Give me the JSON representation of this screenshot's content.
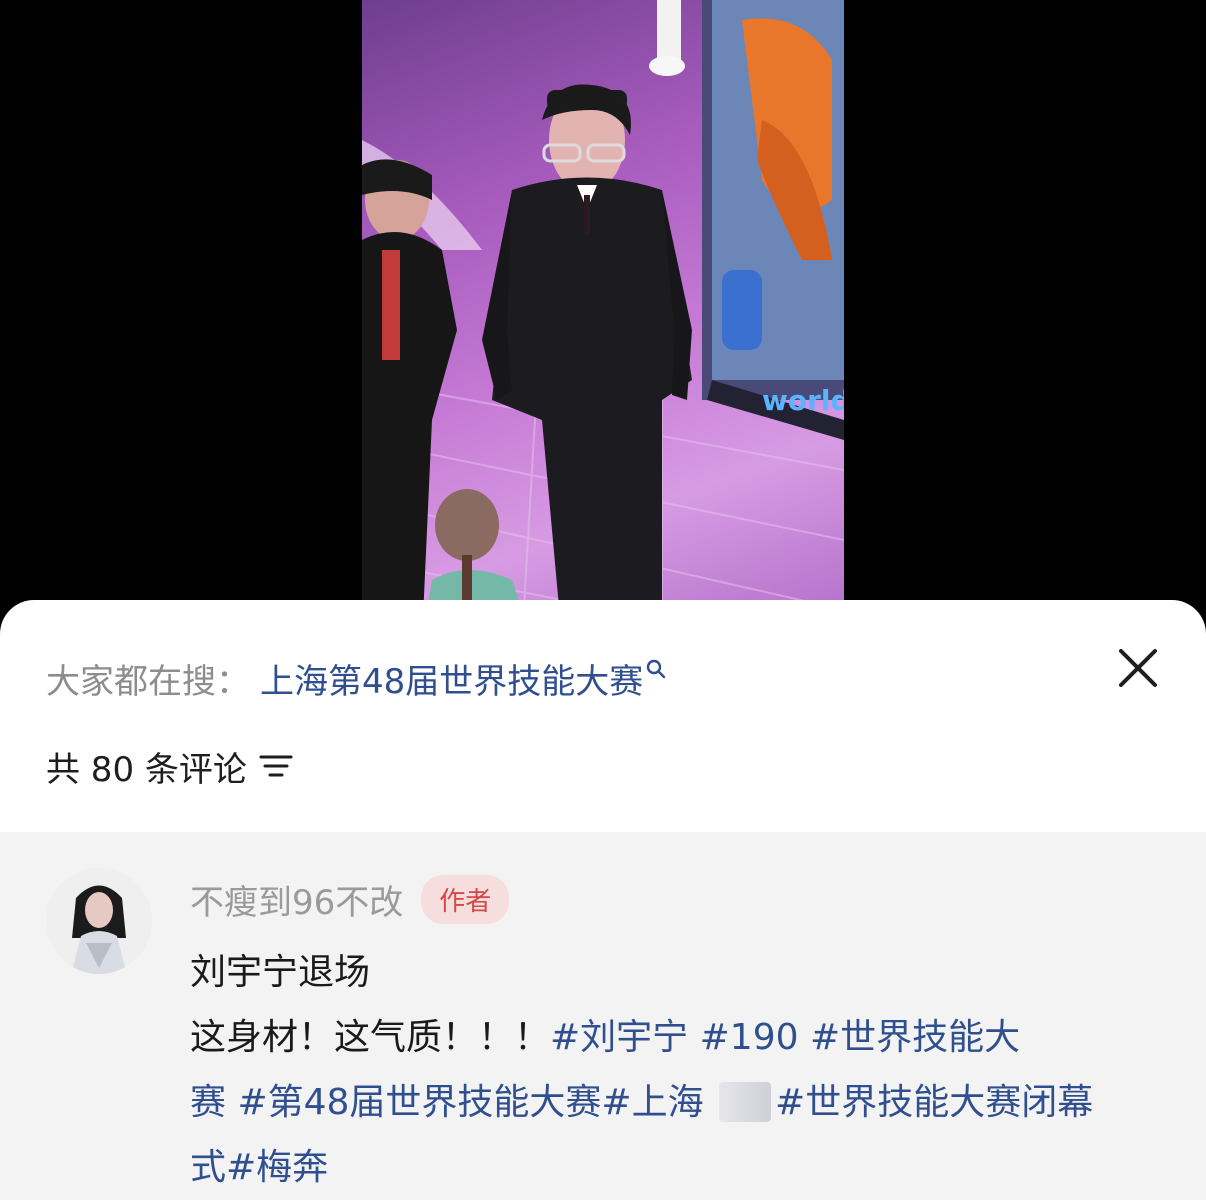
{
  "search_bar": {
    "prefix": "大家都在搜：",
    "query": "上海第48届世界技能大赛"
  },
  "comments_header": {
    "count_text": "共 80 条评论"
  },
  "comment": {
    "username": "不瘦到96不改",
    "badge": "作者",
    "line1": "刘宇宁退场",
    "line2_text": "这身材！这气质！！！",
    "line2_tags": "#刘宇宁 #190 #世界技能大",
    "line3_tag_a": "赛 #第48届世界技能大赛#上海 ",
    "line3_tag_b": "#世界技能大赛闭幕",
    "line4_tags": "式#梅奔"
  },
  "colors": {
    "link": "#2f4f8f",
    "badge_bg": "#f7dede",
    "badge_text": "#d34848",
    "comment_bg": "#f3f3f3"
  },
  "icons": [
    "search-icon",
    "close-icon",
    "sort-icon"
  ]
}
